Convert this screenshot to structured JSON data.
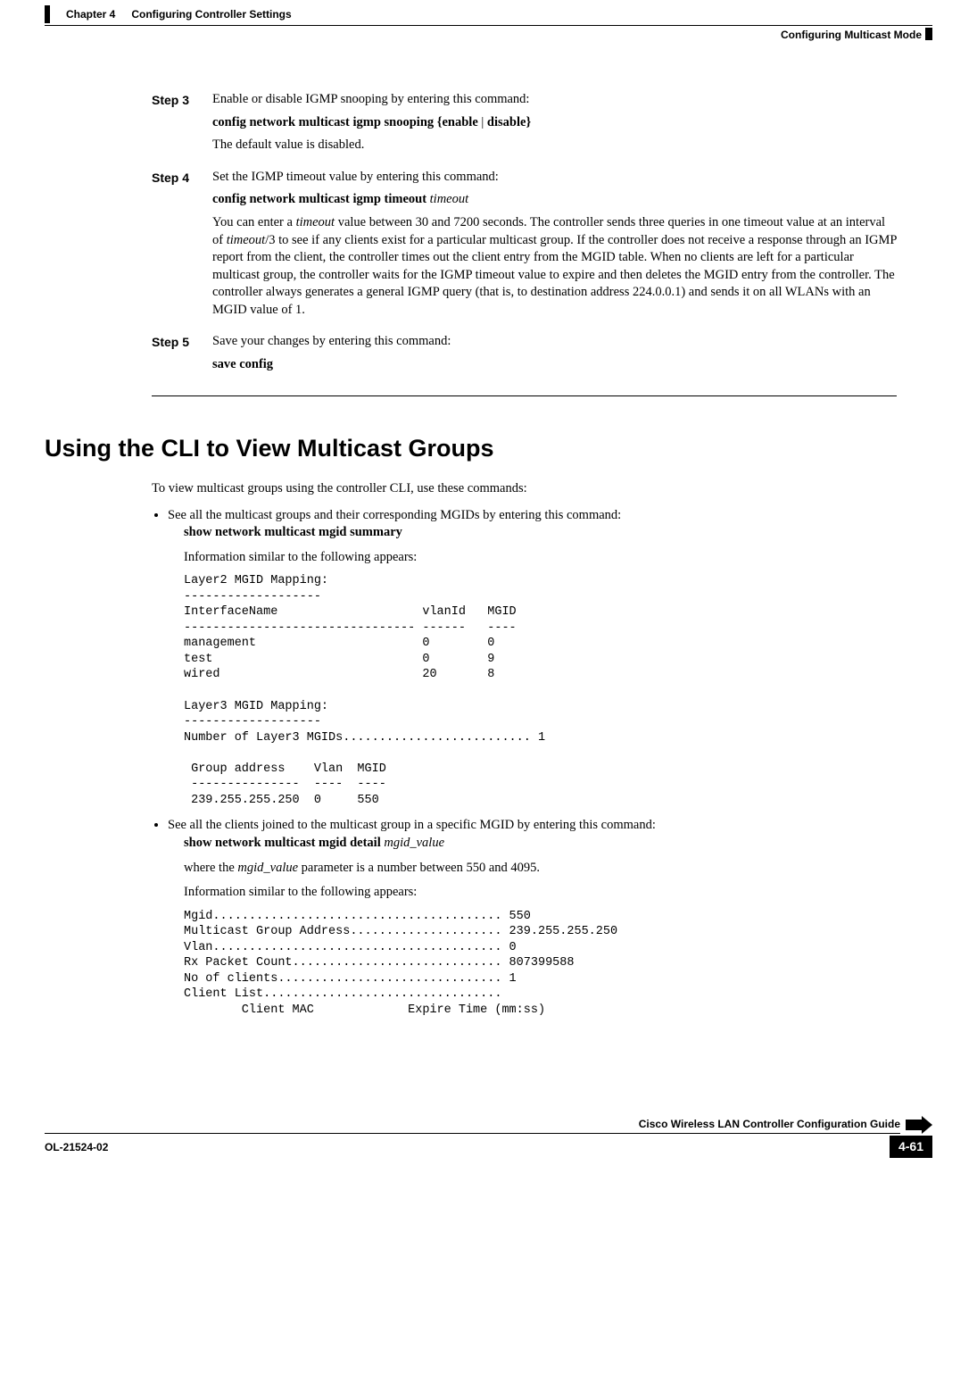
{
  "header": {
    "chapter": "Chapter 4",
    "chapter_title": "Configuring Controller Settings",
    "section_right": "Configuring Multicast Mode"
  },
  "steps": [
    {
      "label": "Step 3",
      "intro": "Enable or disable IGMP snooping by entering this command:",
      "command_pre": "config network multicast igmp snooping",
      "command_arg": "{",
      "command_opt1": "enable",
      "command_sep": " | ",
      "command_opt2": "disable",
      "command_close": "}",
      "post": "The default value is disabled."
    },
    {
      "label": "Step 4",
      "intro": "Set the IGMP timeout value by entering this command:",
      "command_pre": "config network multicast igmp timeout",
      "command_em": "timeout",
      "post_long": "You can enter a <em>timeout</em> value between 30 and 7200 seconds. The controller sends three queries in one timeout value at an interval of <em>timeout</em>/3 to see if any clients exist for a particular multicast group. If the controller does not receive a response through an IGMP report from the client, the controller times out the client entry from the MGID table. When no clients are left for a particular multicast group, the controller waits for the IGMP timeout value to expire and then deletes the MGID entry from the controller. The controller always generates a general IGMP query (that is, to destination address 224.0.0.1) and sends it on all WLANs with an MGID value of 1."
    },
    {
      "label": "Step 5",
      "intro": "Save your changes by entering this command:",
      "command_pre": "save config"
    }
  ],
  "section_title": "Using the CLI to View Multicast Groups",
  "section_intro": "To view multicast groups using the controller CLI, use these commands:",
  "bullets": [
    {
      "lead": "See all the multicast groups and their corresponding MGIDs by entering this command:",
      "cmd": "show network multicast mgid summary",
      "info": "Information similar to the following appears:",
      "pre": "Layer2 MGID Mapping:\n-------------------\nInterfaceName                    vlanId   MGID\n-------------------------------- ------   ----\nmanagement                       0        0\ntest                             0        9\nwired                            20       8\n\nLayer3 MGID Mapping:\n-------------------\nNumber of Layer3 MGIDs.......................... 1\n\n Group address    Vlan  MGID\n ---------------  ----  ----\n 239.255.255.250  0     550"
    },
    {
      "lead": "See all the clients joined to the multicast group in a specific MGID by entering this command:",
      "cmd_pre": "show network multicast mgid detail",
      "cmd_em": "mgid_value",
      "where_pre": "where the ",
      "where_em": "mgid_value",
      "where_post": " parameter is a number between 550 and 4095.",
      "info": "Information similar to the following appears:",
      "pre": "Mgid........................................ 550\nMulticast Group Address..................... 239.255.255.250\nVlan........................................ 0\nRx Packet Count............................. 807399588\nNo of clients............................... 1\nClient List.................................\n        Client MAC             Expire Time (mm:ss)"
    }
  ],
  "footer": {
    "guide_title": "Cisco Wireless LAN Controller Configuration Guide",
    "doc_id": "OL-21524-02",
    "page_num": "4-61"
  }
}
